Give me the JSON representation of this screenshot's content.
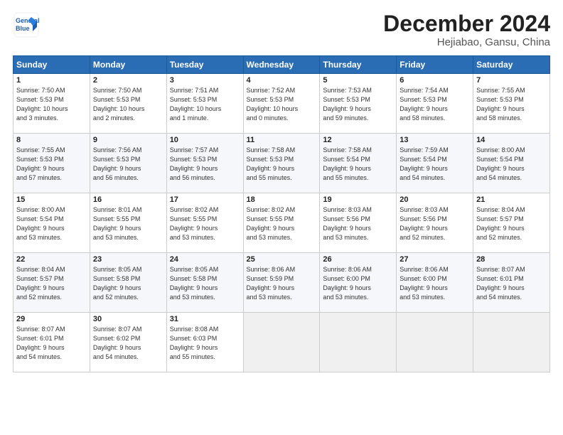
{
  "header": {
    "logo_line1": "General",
    "logo_line2": "Blue",
    "month": "December 2024",
    "location": "Hejiabao, Gansu, China"
  },
  "weekdays": [
    "Sunday",
    "Monday",
    "Tuesday",
    "Wednesday",
    "Thursday",
    "Friday",
    "Saturday"
  ],
  "weeks": [
    [
      {
        "day": "1",
        "info": "Sunrise: 7:50 AM\nSunset: 5:53 PM\nDaylight: 10 hours\nand 3 minutes."
      },
      {
        "day": "2",
        "info": "Sunrise: 7:50 AM\nSunset: 5:53 PM\nDaylight: 10 hours\nand 2 minutes."
      },
      {
        "day": "3",
        "info": "Sunrise: 7:51 AM\nSunset: 5:53 PM\nDaylight: 10 hours\nand 1 minute."
      },
      {
        "day": "4",
        "info": "Sunrise: 7:52 AM\nSunset: 5:53 PM\nDaylight: 10 hours\nand 0 minutes."
      },
      {
        "day": "5",
        "info": "Sunrise: 7:53 AM\nSunset: 5:53 PM\nDaylight: 9 hours\nand 59 minutes."
      },
      {
        "day": "6",
        "info": "Sunrise: 7:54 AM\nSunset: 5:53 PM\nDaylight: 9 hours\nand 58 minutes."
      },
      {
        "day": "7",
        "info": "Sunrise: 7:55 AM\nSunset: 5:53 PM\nDaylight: 9 hours\nand 58 minutes."
      }
    ],
    [
      {
        "day": "8",
        "info": "Sunrise: 7:55 AM\nSunset: 5:53 PM\nDaylight: 9 hours\nand 57 minutes."
      },
      {
        "day": "9",
        "info": "Sunrise: 7:56 AM\nSunset: 5:53 PM\nDaylight: 9 hours\nand 56 minutes."
      },
      {
        "day": "10",
        "info": "Sunrise: 7:57 AM\nSunset: 5:53 PM\nDaylight: 9 hours\nand 56 minutes."
      },
      {
        "day": "11",
        "info": "Sunrise: 7:58 AM\nSunset: 5:53 PM\nDaylight: 9 hours\nand 55 minutes."
      },
      {
        "day": "12",
        "info": "Sunrise: 7:58 AM\nSunset: 5:54 PM\nDaylight: 9 hours\nand 55 minutes."
      },
      {
        "day": "13",
        "info": "Sunrise: 7:59 AM\nSunset: 5:54 PM\nDaylight: 9 hours\nand 54 minutes."
      },
      {
        "day": "14",
        "info": "Sunrise: 8:00 AM\nSunset: 5:54 PM\nDaylight: 9 hours\nand 54 minutes."
      }
    ],
    [
      {
        "day": "15",
        "info": "Sunrise: 8:00 AM\nSunset: 5:54 PM\nDaylight: 9 hours\nand 53 minutes."
      },
      {
        "day": "16",
        "info": "Sunrise: 8:01 AM\nSunset: 5:55 PM\nDaylight: 9 hours\nand 53 minutes."
      },
      {
        "day": "17",
        "info": "Sunrise: 8:02 AM\nSunset: 5:55 PM\nDaylight: 9 hours\nand 53 minutes."
      },
      {
        "day": "18",
        "info": "Sunrise: 8:02 AM\nSunset: 5:55 PM\nDaylight: 9 hours\nand 53 minutes."
      },
      {
        "day": "19",
        "info": "Sunrise: 8:03 AM\nSunset: 5:56 PM\nDaylight: 9 hours\nand 53 minutes."
      },
      {
        "day": "20",
        "info": "Sunrise: 8:03 AM\nSunset: 5:56 PM\nDaylight: 9 hours\nand 52 minutes."
      },
      {
        "day": "21",
        "info": "Sunrise: 8:04 AM\nSunset: 5:57 PM\nDaylight: 9 hours\nand 52 minutes."
      }
    ],
    [
      {
        "day": "22",
        "info": "Sunrise: 8:04 AM\nSunset: 5:57 PM\nDaylight: 9 hours\nand 52 minutes."
      },
      {
        "day": "23",
        "info": "Sunrise: 8:05 AM\nSunset: 5:58 PM\nDaylight: 9 hours\nand 52 minutes."
      },
      {
        "day": "24",
        "info": "Sunrise: 8:05 AM\nSunset: 5:58 PM\nDaylight: 9 hours\nand 53 minutes."
      },
      {
        "day": "25",
        "info": "Sunrise: 8:06 AM\nSunset: 5:59 PM\nDaylight: 9 hours\nand 53 minutes."
      },
      {
        "day": "26",
        "info": "Sunrise: 8:06 AM\nSunset: 6:00 PM\nDaylight: 9 hours\nand 53 minutes."
      },
      {
        "day": "27",
        "info": "Sunrise: 8:06 AM\nSunset: 6:00 PM\nDaylight: 9 hours\nand 53 minutes."
      },
      {
        "day": "28",
        "info": "Sunrise: 8:07 AM\nSunset: 6:01 PM\nDaylight: 9 hours\nand 54 minutes."
      }
    ],
    [
      {
        "day": "29",
        "info": "Sunrise: 8:07 AM\nSunset: 6:01 PM\nDaylight: 9 hours\nand 54 minutes."
      },
      {
        "day": "30",
        "info": "Sunrise: 8:07 AM\nSunset: 6:02 PM\nDaylight: 9 hours\nand 54 minutes."
      },
      {
        "day": "31",
        "info": "Sunrise: 8:08 AM\nSunset: 6:03 PM\nDaylight: 9 hours\nand 55 minutes."
      },
      null,
      null,
      null,
      null
    ]
  ]
}
